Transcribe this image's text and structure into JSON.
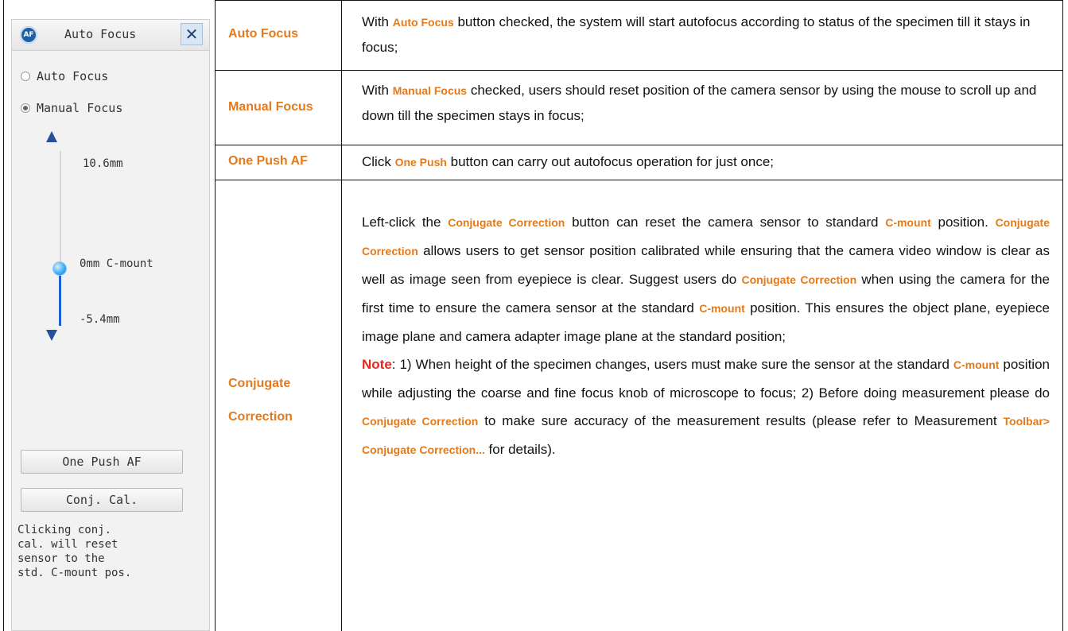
{
  "panel": {
    "badge": "AF",
    "title": "Auto Focus",
    "close": "✕",
    "radios": [
      {
        "label": "Auto Focus",
        "checked": false
      },
      {
        "label": "Manual Focus",
        "checked": true
      }
    ],
    "scale": {
      "top": "10.6mm",
      "middle": "0mm C-mount",
      "bottom": "-5.4mm"
    },
    "buttons": {
      "one_push": "One Push AF",
      "conj_cal": "Conj. Cal."
    },
    "note": "Clicking conj.\ncal. will reset\nsensor to the\nstd. C-mount pos."
  },
  "table": {
    "rows": [
      {
        "label": "Auto Focus",
        "p1": "With ",
        "e1": "Auto Focus",
        "p2": " button checked, the system will start autofocus according to status of the specimen till it stays in focus;"
      },
      {
        "label": "Manual Focus",
        "p1": "With ",
        "e1": "Manual Focus",
        "p2": " checked, users should reset position of the camera sensor by using the mouse to scroll up and down till the specimen stays in focus;"
      },
      {
        "label": "One Push AF",
        "p1": "Click ",
        "e1": "One Push",
        "p2": " button can carry out autofocus operation for just once;"
      },
      {
        "label_line1": "Conjugate",
        "label_line2": "Correction",
        "t1": "Left-click the ",
        "e1": "Conjugate Correction",
        "t2": " button can reset the camera sensor to standard ",
        "e2": "C-mount",
        "t3": " position. ",
        "e3": "Conjugate Correction",
        "t4": " allows users to get sensor position calibrated while ensuring that the camera video window is clear as well as image seen from eyepiece is clear. Suggest users do ",
        "e4": "Conjugate Correction",
        "t5": " when using the camera for the first time to ensure the camera sensor at the standard ",
        "e5": "C-mount",
        "t6": " position. This ensures the object plane, eyepiece image plane and camera adapter image plane at the standard position;",
        "note_label": "Note",
        "n1": ": 1) When height of the specimen changes, users must make sure the sensor at the standard ",
        "e6": "C-mount",
        "n2": " position while adjusting the coarse and fine focus knob of microscope to focus; 2) Before doing measurement please do ",
        "e7": "Conjugate Correction",
        "n3": " to make sure accuracy of the measurement results (please refer to Measurement ",
        "e8": "Toolbar> Conjugate Correction...",
        "n4": " for details)."
      }
    ]
  }
}
